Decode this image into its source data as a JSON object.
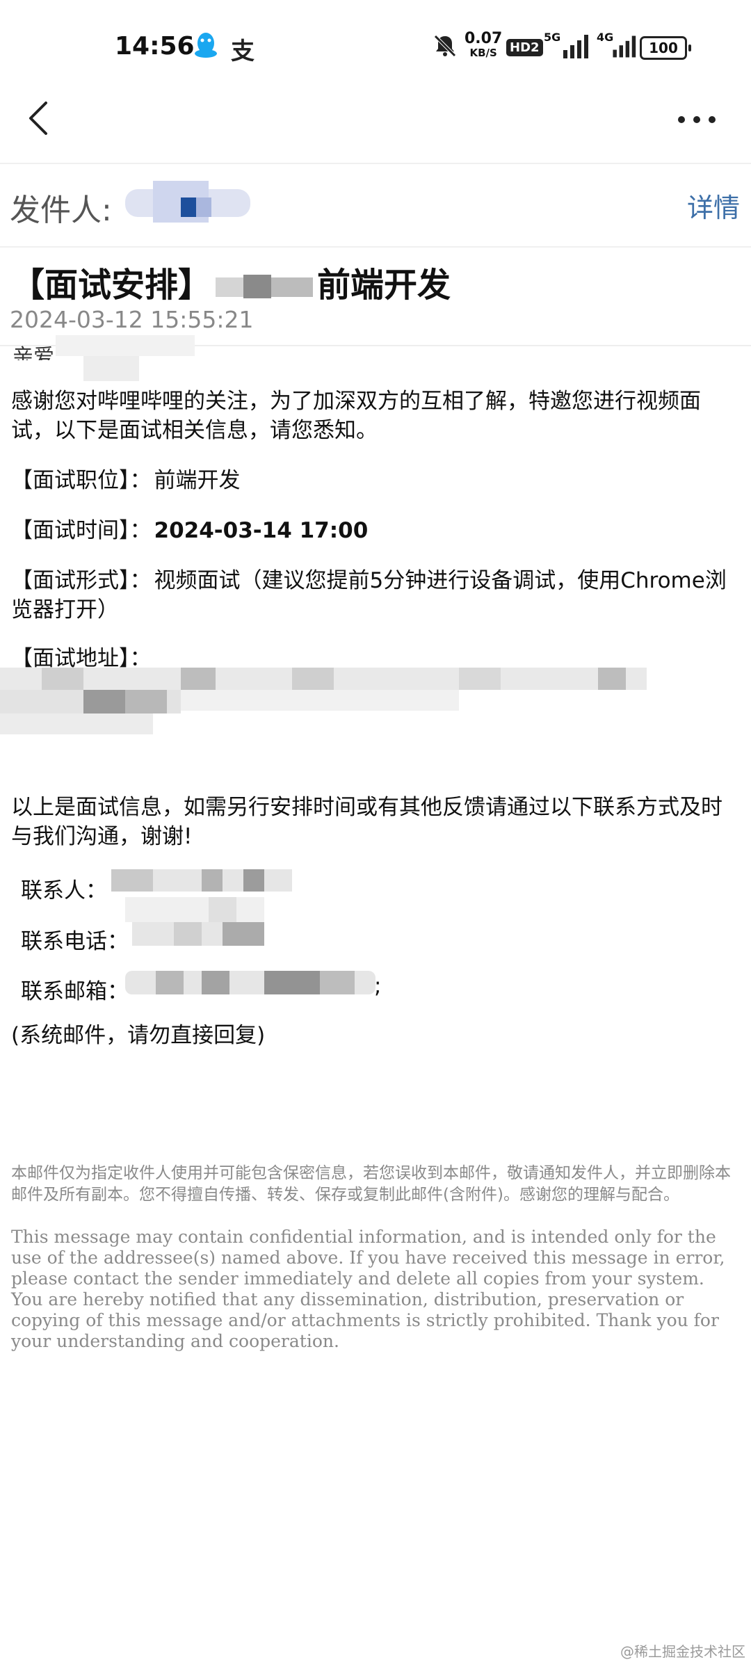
{
  "status_bar": {
    "time": "14:56",
    "alipay_glyph": "支",
    "net_speed_value": "0.07",
    "net_speed_unit": "KB/S",
    "hd_label": "HD2",
    "net1_label": "5G",
    "net2_label": "4G",
    "battery": "100",
    "icons": [
      "qq-icon",
      "alipay-icon",
      "mute-bell-icon",
      "hd-voice-icon",
      "signal-5g-icon",
      "signal-4g-icon",
      "battery-icon"
    ]
  },
  "nav": {
    "icons": [
      "back-chevron-icon",
      "more-dots-icon"
    ]
  },
  "email": {
    "sender_label": "发件人:",
    "details_link": "详情",
    "subject_prefix": "【面试安排】",
    "subject_suffix": "前端开发",
    "date": "2024-03-12 15:55:21",
    "greeting": "亲爱",
    "intro": "感谢您对哔哩哔哩的关注，为了加深双方的互相了解，特邀您进行视频面试，以下是面试相关信息，请您悉知。",
    "fields": [
      {
        "label": "【面试职位】：",
        "value": "前端开发"
      },
      {
        "label": "【面试时间】：",
        "value": "2024-03-14 17:00"
      },
      {
        "label": "【面试形式】：",
        "value": "视频面试（建议您提前5分钟进行设备调试，使用Chrome浏览器打开）"
      },
      {
        "label": "【面试地址】：",
        "value": "htt"
      }
    ],
    "closing": "以上是面试信息，如需另行安排时间或有其他反馈请通过以下联系方式及时与我们沟通，谢谢!",
    "contacts": [
      {
        "label": "联系人："
      },
      {
        "label": "联系电话："
      },
      {
        "label": "联系邮箱：",
        "trailing": ";"
      }
    ],
    "system_note": "(系统邮件，请勿直接回复)",
    "disclaimer_cn": "本邮件仅为指定收件人使用并可能包含保密信息，若您误收到本邮件，敬请通知发件人，并立即删除本邮件及所有副本。您不得擅自传播、转发、保存或复制此邮件(含附件)。感谢您的理解与配合。",
    "disclaimer_en": "This message may contain confidential information, and is intended only for the use of the addressee(s) named above. If you have received this message in error, please contact the sender immediately and delete all copies from your system. You are hereby notified that any dissemination, distribution, preservation or copying of this message and/or attachments is strictly prohibited. Thank you for your understanding and cooperation."
  },
  "watermark": "@稀土掘金技术社区",
  "colors": {
    "link": "#3d6fa8",
    "muted": "#8a8a8a",
    "blur_dark": "#8a8a8a",
    "blur_light": "#e6e6e6"
  }
}
